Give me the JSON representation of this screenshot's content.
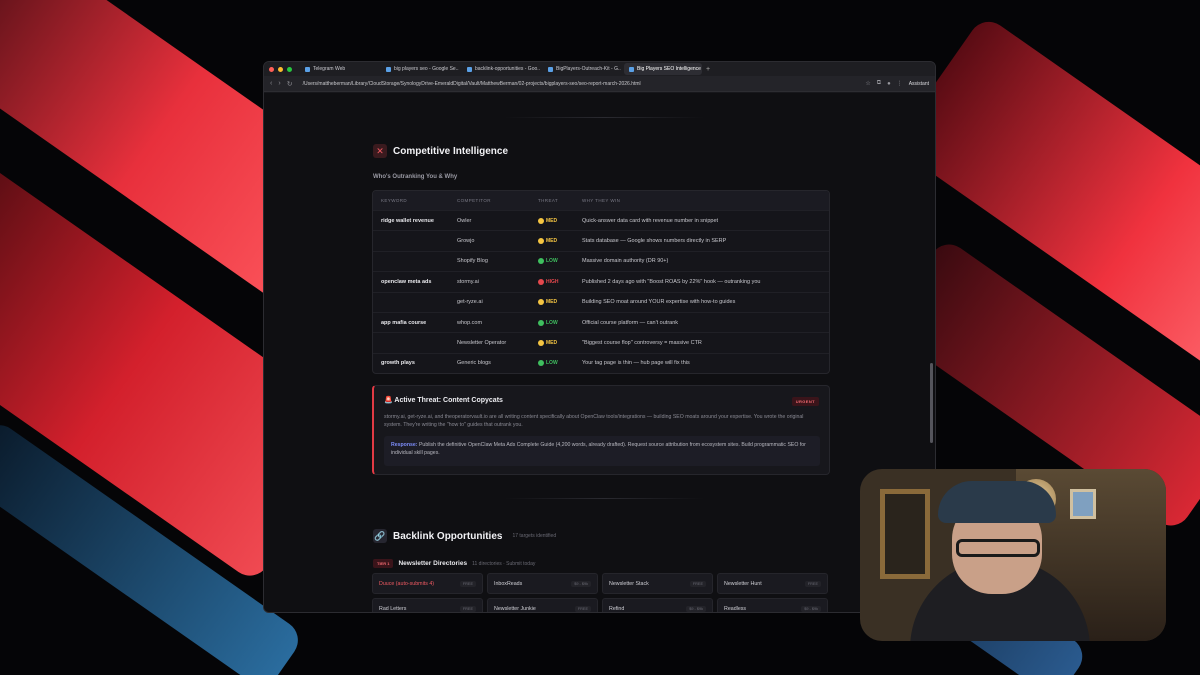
{
  "browser": {
    "tabs": [
      {
        "label": "Telegram Web",
        "active": false
      },
      {
        "label": "big players seo - Google Se...",
        "active": false
      },
      {
        "label": "backlink-opportunities - Goo...",
        "active": false
      },
      {
        "label": "BigPlayers-Outreach-Kit - G...",
        "active": false
      },
      {
        "label": "Big Players SEO Intelligence",
        "active": true
      }
    ],
    "new_tab": "+",
    "url": "/Users/mattheberman/Library/CloudStorage/SynologyDrive-EmeraldDigital/Vault/MatthewBerman/02-projects/bigplayers-seo/seo-report-march-2026.html",
    "assistant_label": "Assistant"
  },
  "competitive": {
    "icon": "crossed-swords-icon",
    "title": "Competitive Intelligence",
    "subtitle": "Who's Outranking You & Why",
    "columns": [
      "KEYWORD",
      "COMPETITOR",
      "THREAT",
      "WHY THEY WIN"
    ],
    "rows": [
      {
        "keyword": "ridge wallet revenue",
        "competitor": "Owler",
        "threat": "MED",
        "why": "Quick-answer data card with revenue number in snippet"
      },
      {
        "keyword": "",
        "competitor": "Growjo",
        "threat": "MED",
        "why": "Stats database — Google shows numbers directly in SERP"
      },
      {
        "keyword": "",
        "competitor": "Shopify Blog",
        "threat": "LOW",
        "why": "Massive domain authority (DR 90+)"
      },
      {
        "keyword": "openclaw meta ads",
        "competitor": "stormy.ai",
        "threat": "HIGH",
        "why": "Published 2 days ago with \"Boost ROAS by 22%\" hook — outranking you"
      },
      {
        "keyword": "",
        "competitor": "get-ryze.ai",
        "threat": "MED",
        "why": "Building SEO moat around YOUR expertise with how-to guides"
      },
      {
        "keyword": "app mafia course",
        "competitor": "whop.com",
        "threat": "LOW",
        "why": "Official course platform — can't outrank"
      },
      {
        "keyword": "",
        "competitor": "Newsletter Operator",
        "threat": "MED",
        "why": "\"Biggest course flop\" controversy = massive CTR"
      },
      {
        "keyword": "growth plays",
        "competitor": "Generic blogs",
        "threat": "LOW",
        "why": "Your tag page is thin — hub page will fix this"
      }
    ],
    "threat_colors": {
      "HIGH": "#e5484d",
      "MED": "#f5c542",
      "LOW": "#3fbf5f"
    }
  },
  "alert": {
    "title": "🚨 Active Threat: Content Copycats",
    "badge": "URGENT",
    "body": "stormy.ai, get-ryze.ai, and theoperatorvault.io are all writing content specifically about OpenClaw tools/integrations — building SEO moats around your expertise. You wrote the original system. They're writing the \"how to\" guides that outrank you.",
    "response_label": "Response:",
    "response_text": " Publish the definitive OpenClaw Meta Ads Complete Guide (4,200 words, already drafted). Request source attribution from ecosystem sites. Build programmatic SEO for individual skill pages."
  },
  "backlinks": {
    "icon": "link-icon",
    "title": "Backlink Opportunities",
    "count": "17 targets identified",
    "tier_badge": "TIER 1",
    "tier_name": "Newsletter Directories",
    "tier_sub": "11 directories · Submit today",
    "cards": [
      {
        "name": "Duuce (auto-submits 4)",
        "tag": "FREE",
        "highlight": true
      },
      {
        "name": "InboxReads",
        "tag": "$9 - $9k",
        "highlight": false
      },
      {
        "name": "Newsletter Stack",
        "tag": "FREE",
        "highlight": false
      },
      {
        "name": "Newsletter Hunt",
        "tag": "FREE",
        "highlight": false
      },
      {
        "name": "Rad Letters",
        "tag": "FREE",
        "highlight": false
      },
      {
        "name": "Newsletter Junkie",
        "tag": "FREE",
        "highlight": false
      },
      {
        "name": "Refind",
        "tag": "$9 - $9k",
        "highlight": false
      },
      {
        "name": "Readless",
        "tag": "$9 - $9k",
        "highlight": false
      }
    ]
  }
}
